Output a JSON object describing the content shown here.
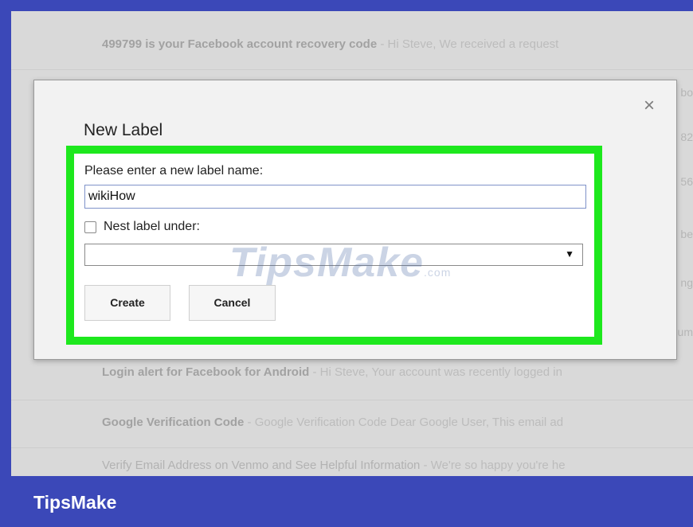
{
  "email_list": [
    {
      "subject": "499799 is your Facebook account recovery code",
      "snippet": " - Hi Steve, We received a request"
    },
    {
      "subject": "Login alert for Facebook for Android",
      "snippet": " - Hi Steve, Your account was recently logged in"
    },
    {
      "subject": "Google Verification Code",
      "snippet": " - Google Verification Code Dear Google User, This email ad"
    },
    {
      "subject": "Verify Email Address on Venmo and See Helpful Information",
      "snippet": " - We're so happy you're he"
    }
  ],
  "peek_text": [
    "bo",
    "82",
    "56",
    "be",
    "ng",
    "um",
    "in"
  ],
  "dialog": {
    "title": "New Label",
    "close_glyph": "×",
    "prompt": "Please enter a new label name:",
    "name_value": "wikiHow",
    "nest_label": "Nest label under:",
    "nest_selected": "",
    "select_arrow_glyph": "▼",
    "create_label": "Create",
    "cancel_label": "Cancel"
  },
  "watermark": {
    "text": "TipsMake",
    "tld": ".com"
  },
  "footer": {
    "brand": "TipsMake"
  },
  "colors": {
    "frame": "#3b48b8",
    "highlight": "#1de81d",
    "input_border": "#7f92c9"
  }
}
